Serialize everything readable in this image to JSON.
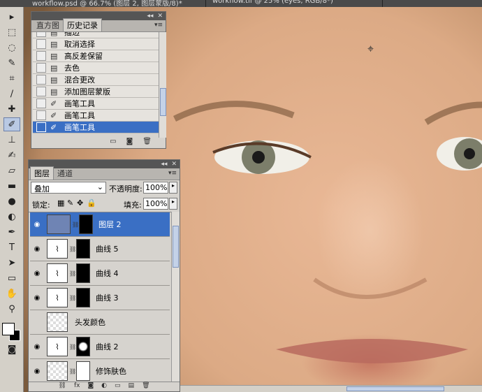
{
  "doc_tabs": [
    "workflow.psd @ 66.7% (图层 2, 图层蒙版/8)*",
    "workflow.tif @ 25% (eyes, RGB/8*)"
  ],
  "history": {
    "tabs": [
      "直方图",
      "历史记录"
    ],
    "items": [
      "描边",
      "取消选择",
      "高反差保留",
      "去色",
      "混合更改",
      "添加图层蒙版",
      "画笔工具",
      "画笔工具",
      "画笔工具"
    ]
  },
  "layers": {
    "tabs": [
      "图层",
      "通道"
    ],
    "blend_mode": "叠加",
    "opacity_label": "不透明度:",
    "opacity": "100%",
    "lock_label": "锁定:",
    "fill_label": "填充:",
    "fill": "100%",
    "items": [
      "图层 2",
      "曲线 5",
      "曲线 4",
      "曲线 3",
      "头发颜色",
      "曲线 2",
      "修饰肤色"
    ]
  },
  "cursor_glyph": "⌖",
  "icons": [
    "move-icon",
    "marquee-icon",
    "lasso-icon",
    "quick-select-icon",
    "crop-icon",
    "eyedropper-icon",
    "heal-icon",
    "brush-icon",
    "stamp-icon",
    "history-brush-icon",
    "eraser-icon",
    "gradient-icon",
    "blur-icon",
    "dodge-icon",
    "pen-icon",
    "type-icon",
    "path-select-icon",
    "shape-icon",
    "hand-icon",
    "zoom-icon"
  ]
}
